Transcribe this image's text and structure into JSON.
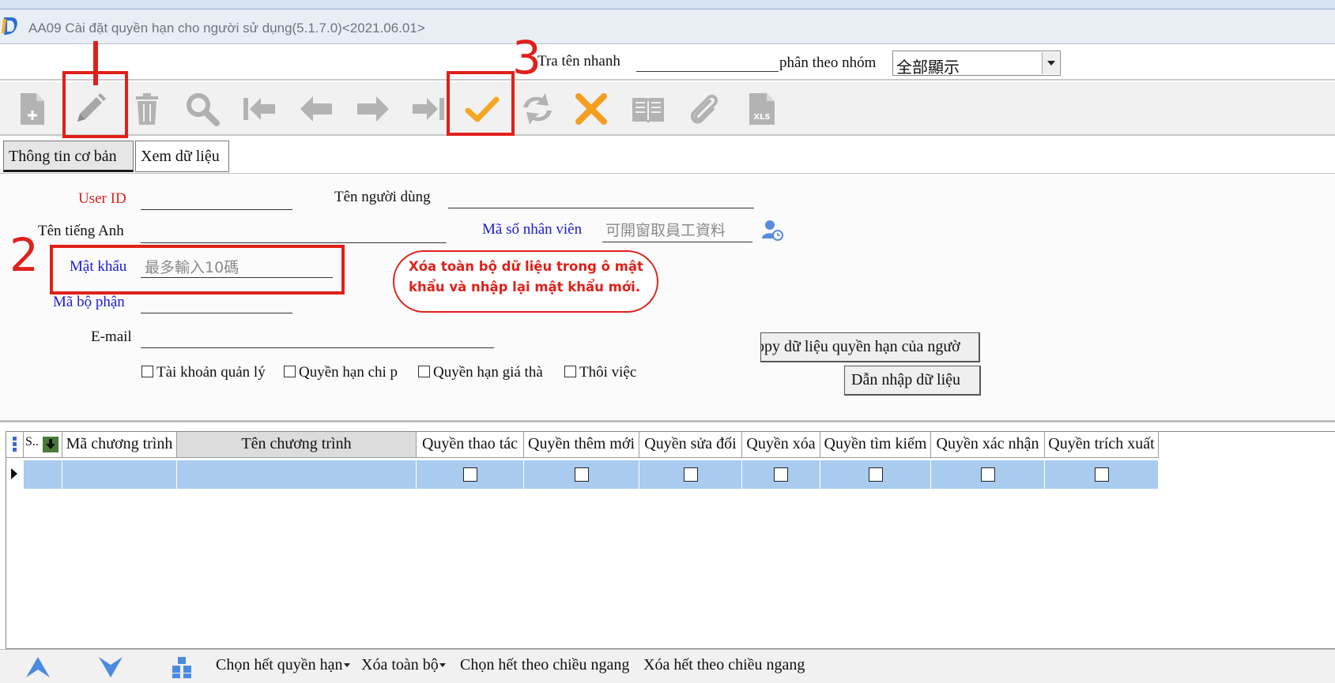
{
  "window": {
    "title": "AA09 Cài đặt quyền hạn cho người sử dụng(5.1.7.0)<2021.06.01>"
  },
  "search": {
    "quick_label": "Tra tên nhanh",
    "group_label": "phân theo nhóm",
    "group_value": "全部顯示"
  },
  "toolbar": {
    "buttons": [
      "new-file-icon",
      "edit-pencil-icon",
      "delete-trash-icon",
      "search-icon",
      "first-record-icon",
      "prev-record-icon",
      "next-record-icon",
      "last-record-icon",
      "confirm-check-icon",
      "refresh-icon",
      "cancel-x-icon",
      "book-icon",
      "attachment-icon",
      "export-xls-icon"
    ],
    "xls_label": "XLS"
  },
  "tabs": [
    {
      "label": "Thông tin cơ bản",
      "active": true
    },
    {
      "label": "Xem dữ liệu",
      "active": false
    }
  ],
  "form": {
    "user_id_label": "User ID",
    "user_name_label": "Tên người dùng",
    "english_name_label": "Tên tiếng Anh",
    "employee_id_label": "Mã số nhân viên",
    "employee_id_placeholder": "可開窗取員工資料",
    "password_label": "Mật khẩu",
    "password_placeholder": "最多輸入10碼",
    "dept_label": "Mã bộ phận",
    "email_label": "E-mail",
    "checkboxes": [
      "Tài khoản quản lý",
      "Quyền hạn chi p",
      "Quyền hạn giá thà",
      "Thôi việc"
    ],
    "copy_button": "opy dữ liệu quyền hạn của ngườ",
    "import_button": "Dẫn nhập dữ liệu"
  },
  "grid": {
    "row_header": "S..",
    "columns": [
      "Mã chương trình",
      "Tên chương trình",
      "Quyền thao tác",
      "Quyền thêm mới",
      "Quyền sửa đổi",
      "Quyền xóa",
      "Quyền tìm kiếm",
      "Quyền xác nhận",
      "Quyền trích xuất"
    ],
    "selected_column": "Tên chương trình"
  },
  "bottombar": {
    "select_all": "Chọn hết quyền hạn",
    "clear_all": "Xóa toàn bộ",
    "select_horizontal": "Chọn hết theo chiều ngang",
    "clear_horizontal": "Xóa hết theo chiều ngang"
  },
  "annotations": {
    "note": "Xóa toàn bộ dữ liệu trong ô mật khẩu và nhập lại mật khẩu mới.",
    "step1": "1",
    "step2": "2",
    "step3": "3"
  },
  "colors": {
    "accent_red": "#e0201a",
    "label_blue": "#1a1ad4",
    "row_selected": "#a9cbf0",
    "check_orange": "#f5a623",
    "cancel_orange": "#f59d1e"
  }
}
